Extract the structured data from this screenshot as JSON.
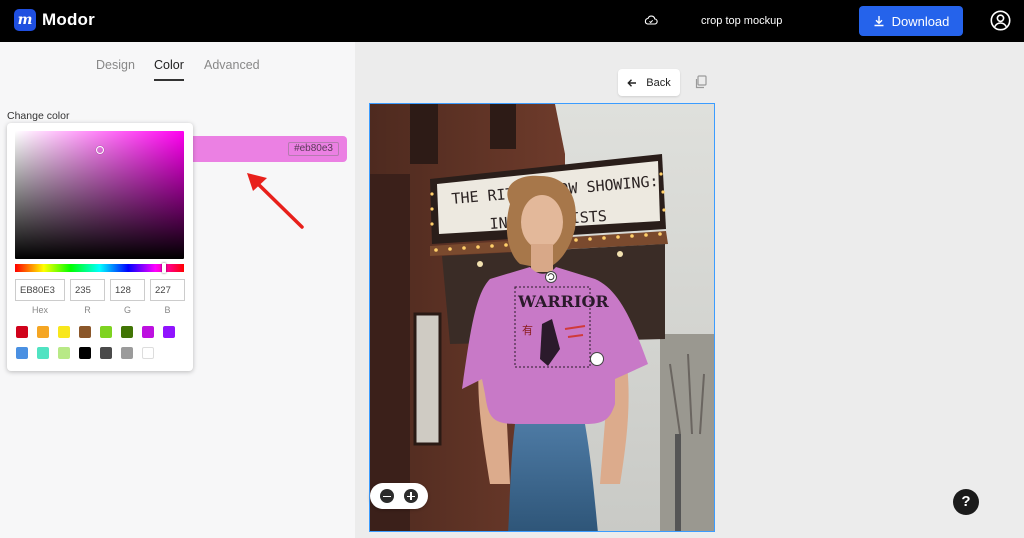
{
  "app": {
    "logo_letter": "m",
    "name": "Modor"
  },
  "header": {
    "project_title": "crop top mockup",
    "download_label": "Download",
    "cloud_icon": "cloud-icon",
    "account_icon": "user-circle-icon"
  },
  "tabs": [
    {
      "label": "Design",
      "active": false
    },
    {
      "label": "Color",
      "active": true
    },
    {
      "label": "Advanced",
      "active": false
    }
  ],
  "color_panel": {
    "label": "Change color",
    "current_color": "#eb80e3",
    "hex_chip": "#eb80e3"
  },
  "picker": {
    "hex_value": "EB80E3",
    "r_value": "235",
    "g_value": "128",
    "b_value": "227",
    "hex_label": "Hex",
    "r_label": "R",
    "g_label": "G",
    "b_label": "B",
    "swatches": [
      "#d0021b",
      "#f5a623",
      "#f8e71c",
      "#8b572a",
      "#7ed321",
      "#417505",
      "#bd10e0",
      "#9013fe",
      "#4a90e2",
      "#50e3c2",
      "#b8e986",
      "#000000",
      "#4a4a4a",
      "#9b9b9b",
      "#ffffff"
    ]
  },
  "workspace": {
    "back_label": "Back",
    "copy_icon": "copy-icon",
    "zoom_out_icon": "minus-circle-icon",
    "zoom_in_icon": "plus-circle-icon",
    "help_label": "?"
  },
  "mockup": {
    "marquee_line1": "THE RITZ - NOW SHOWING:",
    "marquee_line2": "INDIE ARTISTS",
    "shirt_print_title": "WARRIOR",
    "shirt_color": "#c879c7"
  }
}
